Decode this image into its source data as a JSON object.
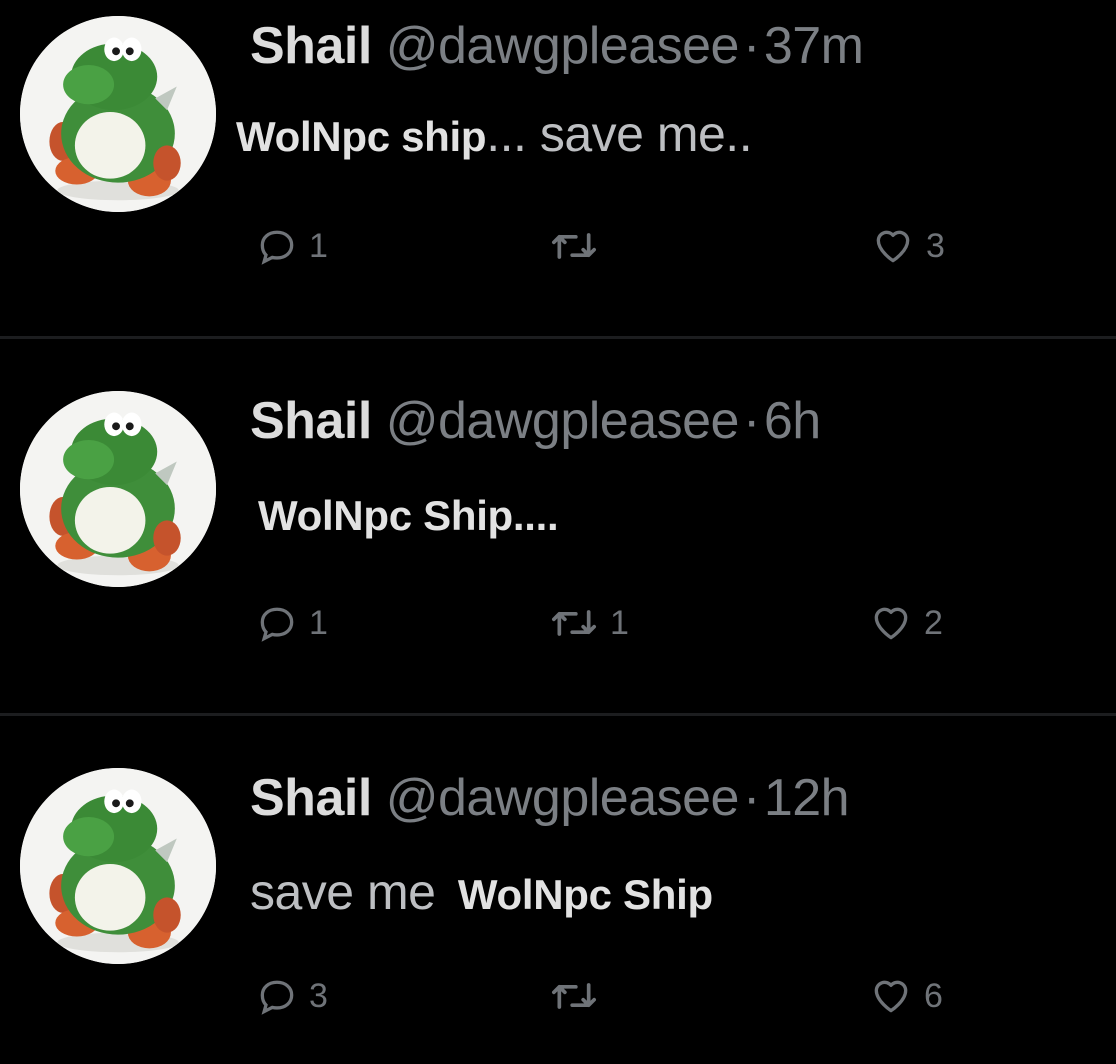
{
  "tweets": [
    {
      "display_name": "Shail",
      "handle": "@dawgpleasee",
      "separator": "·",
      "time": "37m",
      "text_overlay": "WolNpc ship",
      "text_original": "... save me..",
      "replies": "1",
      "retweets": "",
      "likes": "3"
    },
    {
      "display_name": "Shail",
      "handle": "@dawgpleasee",
      "separator": "·",
      "time": "6h",
      "text_overlay": "WolNpc Ship....",
      "text_original": "",
      "replies": "1",
      "retweets": "1",
      "likes": "2"
    },
    {
      "display_name": "Shail",
      "handle": "@dawgpleasee",
      "separator": "·",
      "time": "12h",
      "text_original": "save me",
      "text_overlay": "WolNpc Ship",
      "replies": "3",
      "retweets": "",
      "likes": "6"
    }
  ],
  "icons": {
    "reply": "reply-icon",
    "retweet": "retweet-icon",
    "like": "heart-icon",
    "avatar": "yoshi-avatar"
  },
  "colors": {
    "background": "#000000",
    "name": "#dcdcdc",
    "muted": "#7b7f84",
    "overlay_text": "#e2e2e2",
    "avatar_bg": "#f4f4f2"
  }
}
